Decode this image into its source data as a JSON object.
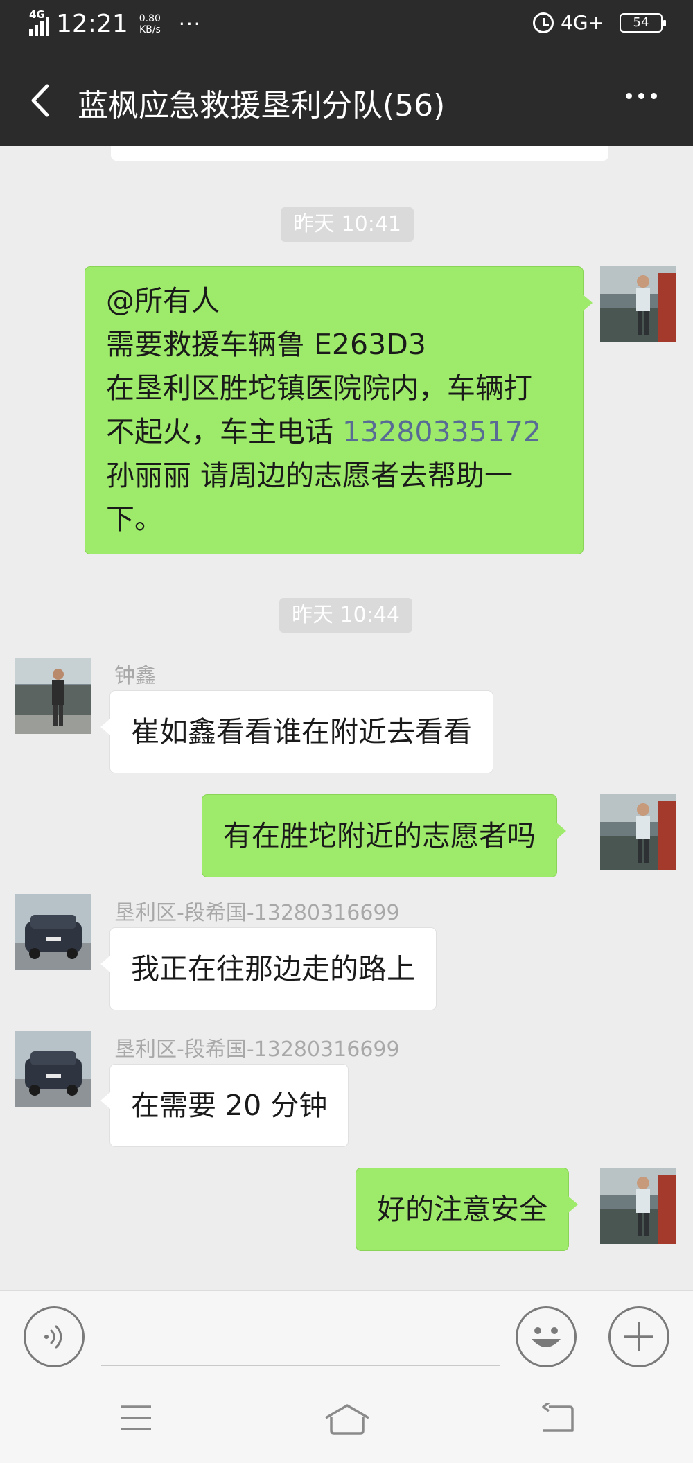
{
  "status_bar": {
    "network_label": "4G",
    "time": "12:21",
    "speed_value": "0.80",
    "speed_unit": "KB/s",
    "more": "···",
    "network_right": "4G+",
    "battery": "54"
  },
  "header": {
    "title": "蓝枫应急救援垦利分队(56)"
  },
  "messages": [
    {
      "type": "timestamp",
      "text": "昨天 10:41"
    },
    {
      "type": "outgoing",
      "lines": [
        "@所有人",
        "需要救援车辆鲁 E263D3",
        "在垦利区胜坨镇医院院内，车辆打",
        "不起火，车主电话 "
      ],
      "phone": "13280335172",
      "tail_lines": [
        "孙丽丽 请周边的志愿者去帮助一",
        "下。"
      ]
    },
    {
      "type": "timestamp",
      "text": "昨天 10:44"
    },
    {
      "type": "incoming",
      "sender": "钟鑫",
      "text": "崔如鑫看看谁在附近去看看"
    },
    {
      "type": "outgoing",
      "text": "有在胜坨附近的志愿者吗"
    },
    {
      "type": "incoming",
      "sender": "垦利区-段希国-13280316699",
      "text": "我正在往那边走的路上"
    },
    {
      "type": "incoming",
      "sender": "垦利区-段希国-13280316699",
      "text": "在需要 20 分钟"
    },
    {
      "type": "outgoing",
      "text": "好的注意安全"
    }
  ],
  "colors": {
    "header_bg": "#2b2b2b",
    "chat_bg": "#ededed",
    "outgoing_bubble": "#9eea6a",
    "incoming_bubble": "#ffffff",
    "phone_link": "#576b95"
  },
  "icons": {
    "voice": "voice-input-icon",
    "emoji": "emoji-icon",
    "plus": "plus-icon",
    "menu": "menu-icon",
    "home": "home-icon",
    "back": "back-icon"
  }
}
